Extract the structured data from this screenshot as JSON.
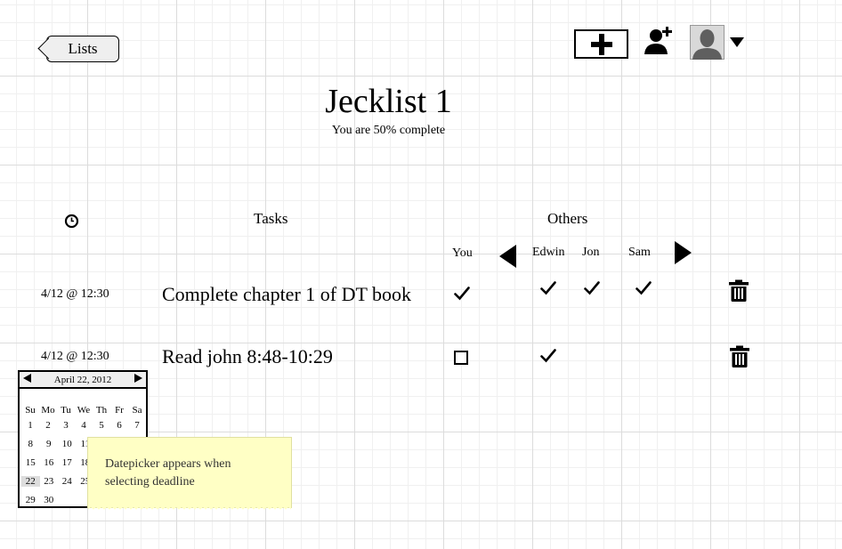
{
  "header": {
    "back_label": "Lists",
    "add_icon": "plus-icon",
    "invite_icon": "add-user-icon",
    "avatar_icon": "user-avatar-icon"
  },
  "list": {
    "title": "Jecklist 1",
    "progress_text": "You are 50% complete"
  },
  "columns": {
    "deadline_icon": "clock-icon",
    "tasks": "Tasks",
    "others": "Others",
    "you": "You",
    "people": [
      "Edwin",
      "Jon",
      "Sam"
    ]
  },
  "tasks": [
    {
      "deadline": "4/12 @ 12:30",
      "name": "Complete chapter 1 of DT book",
      "you_done": true,
      "others_done": [
        true,
        true,
        true
      ]
    },
    {
      "deadline": "4/12 @ 12:30",
      "name": "Read john 8:48-10:29",
      "you_done": false,
      "others_done": [
        true,
        false,
        false
      ]
    }
  ],
  "datepicker": {
    "month_label": "April 22, 2012",
    "weekdays": [
      "Su",
      "Mo",
      "Tu",
      "We",
      "Th",
      "Fr",
      "Sa"
    ],
    "weeks": [
      [
        "1",
        "2",
        "3",
        "4",
        "5",
        "6",
        "7"
      ],
      [
        "8",
        "9",
        "10",
        "11",
        "",
        "",
        ""
      ],
      [
        "15",
        "16",
        "17",
        "18",
        "",
        "",
        ""
      ],
      [
        "22",
        "23",
        "24",
        "25",
        "",
        "",
        ""
      ],
      [
        "29",
        "30",
        "",
        "",
        "",
        "",
        ""
      ]
    ],
    "selected": "22"
  },
  "note": {
    "text": "Datepicker appears when selecting deadline"
  }
}
